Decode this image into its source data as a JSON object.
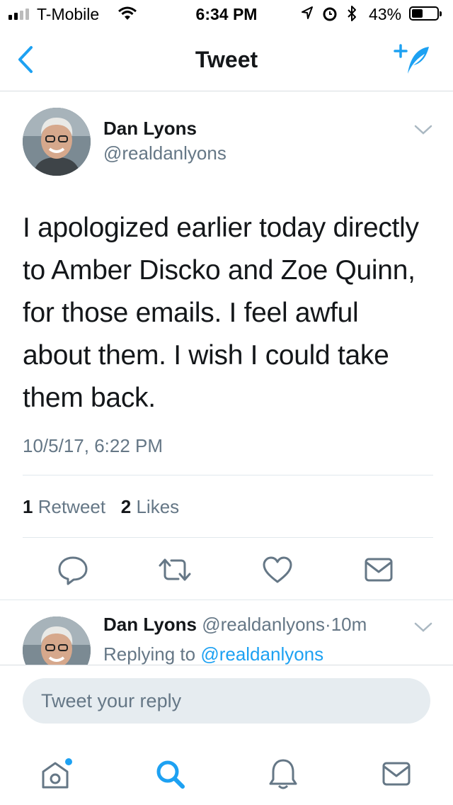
{
  "status_bar": {
    "carrier": "T-Mobile",
    "time": "6:34 PM",
    "battery_percent": "43%",
    "battery_level": 0.43,
    "icons": [
      "signal-icon",
      "wifi-icon",
      "location-icon",
      "alarm-icon",
      "bluetooth-icon",
      "battery-icon"
    ]
  },
  "nav": {
    "title": "Tweet",
    "back_icon": "chevron-left-icon",
    "compose_icon": "compose-tweet-icon"
  },
  "tweet": {
    "author_name": "Dan Lyons",
    "author_handle": "@realdanlyons",
    "text": "I apologized earlier today directly to Amber Discko and Zoe Quinn, for those emails. I feel awful about them. I wish I could take them back.",
    "timestamp": "10/5/17, 6:22 PM",
    "retweet_count": "1",
    "retweet_label": "Retweet",
    "like_count": "2",
    "like_label": "Likes",
    "actions": [
      "reply-icon",
      "retweet-icon",
      "like-icon",
      "direct-message-icon"
    ]
  },
  "reply_preview": {
    "author_name": "Dan Lyons",
    "author_handle": "@realdanlyons",
    "separator": "·",
    "age": "10m",
    "replying_prefix": "Replying to",
    "replying_to": "@realdanlyons"
  },
  "reply_bar": {
    "placeholder": "Tweet your reply"
  },
  "tabbar": {
    "items": [
      "home-icon",
      "search-icon",
      "notifications-icon",
      "messages-icon"
    ],
    "active": "search-icon"
  },
  "colors": {
    "accent": "#1da1f2",
    "text_primary": "#14171a",
    "text_secondary": "#657786",
    "divider": "#e1e8ed",
    "input_bg": "#e6ecf0"
  }
}
